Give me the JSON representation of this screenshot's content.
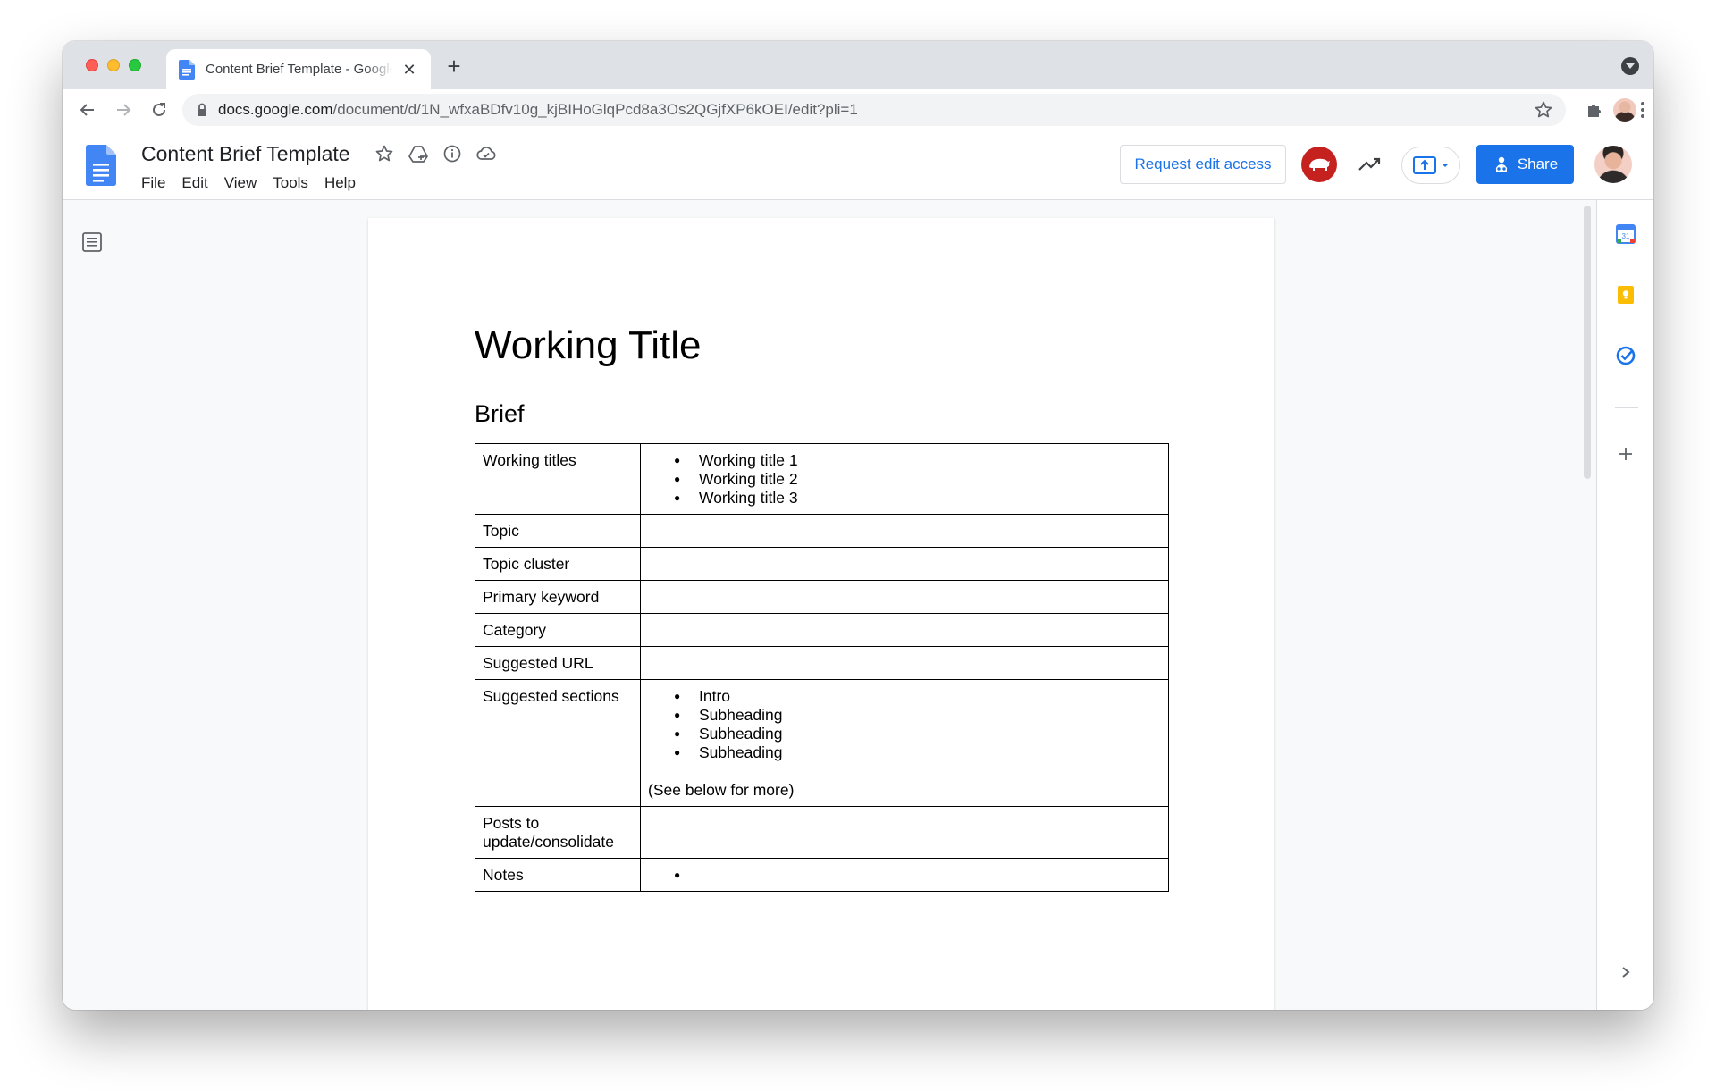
{
  "browser": {
    "tab_title": "Content Brief Template - Google Docs",
    "new_tab": "+",
    "tab_close": "✕",
    "url_host": "docs.google.com",
    "url_path": "/document/d/1N_wfxaBDfv10g_kjBIHoGlqPcd8a3Os2QGjfXP6kOEI/edit?pli=1"
  },
  "docs": {
    "title": "Content Brief Template",
    "menu": [
      "File",
      "Edit",
      "View",
      "Tools",
      "Help"
    ],
    "request_edit": "Request edit access",
    "share": "Share"
  },
  "document": {
    "title": "Working Title",
    "section_heading": "Brief",
    "table": [
      {
        "label": "Working titles",
        "bullets": [
          "Working title 1",
          "Working title 2",
          "Working title 3"
        ],
        "note": ""
      },
      {
        "label": "Topic",
        "bullets": [],
        "note": ""
      },
      {
        "label": "Topic cluster",
        "bullets": [],
        "note": ""
      },
      {
        "label": "Primary keyword",
        "bullets": [],
        "note": ""
      },
      {
        "label": "Category",
        "bullets": [],
        "note": ""
      },
      {
        "label": "Suggested URL",
        "bullets": [],
        "note": ""
      },
      {
        "label": "Suggested sections",
        "bullets": [
          "Intro",
          "Subheading",
          "Subheading",
          "Subheading"
        ],
        "note": "(See below for more)"
      },
      {
        "label": "Posts to update/consolidate",
        "bullets": [],
        "note": ""
      },
      {
        "label": "Notes",
        "bullets": [
          ""
        ],
        "note": ""
      }
    ]
  },
  "side_panel": {
    "calendar_day": "31",
    "icons": [
      "calendar-icon",
      "keep-icon",
      "tasks-icon",
      "add-icon",
      "expand-icon"
    ]
  },
  "colors": {
    "accent": "#1a73e8",
    "share_bg": "#1a73e8",
    "anon_avatar": "#c5221f",
    "docs_blue": "#4285f4"
  }
}
